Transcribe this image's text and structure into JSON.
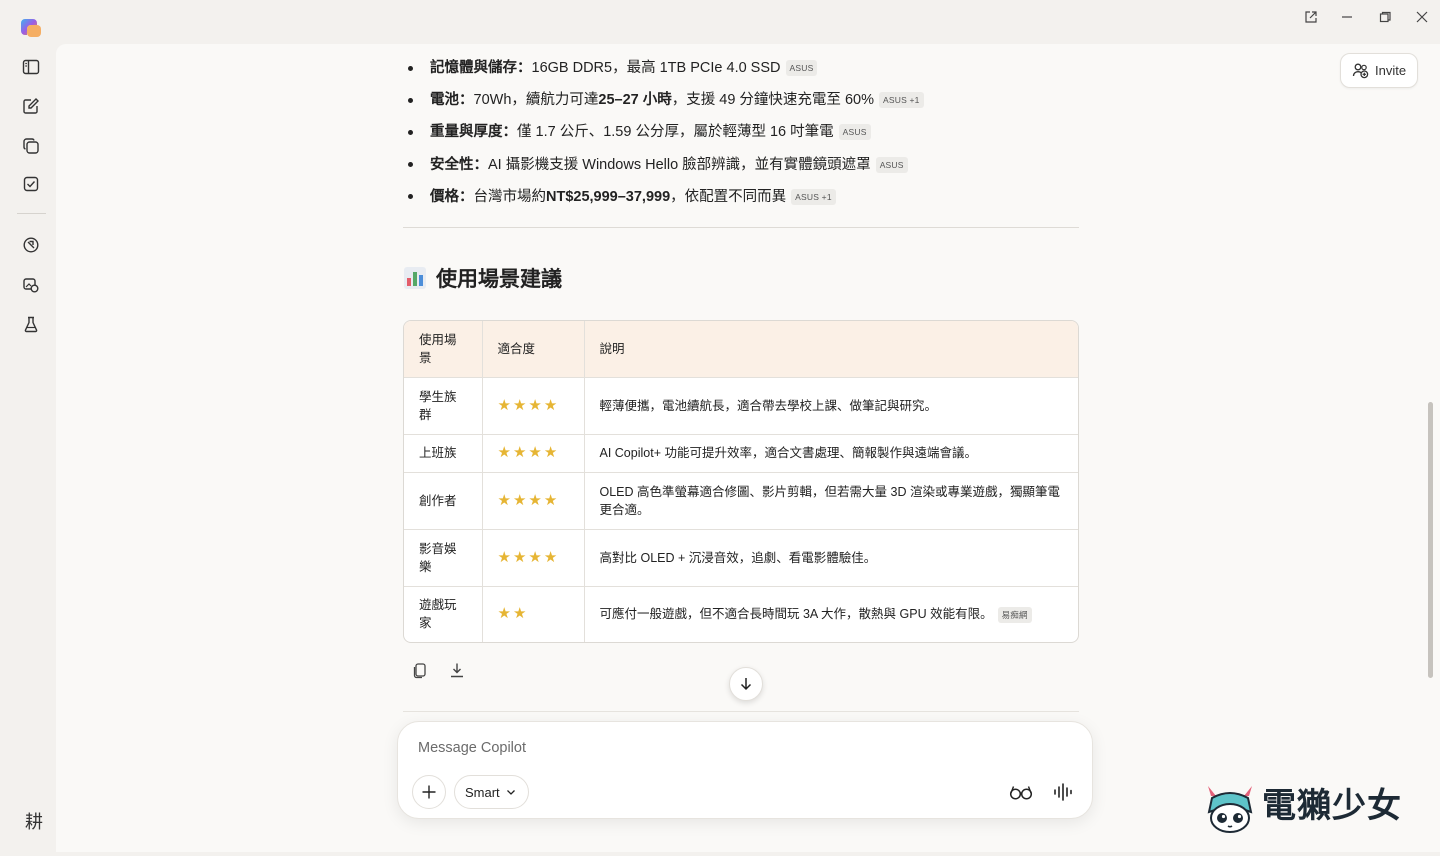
{
  "app": {
    "invite_label": "Invite",
    "user_avatar_text": "耕"
  },
  "specs": [
    {
      "label": "記憶體與儲存",
      "sep": "：",
      "text": "16GB DDR5，最高 1TB PCIe 4.0 SSD",
      "source": "ASUS",
      "extra": ""
    },
    {
      "label": "電池",
      "sep": "：",
      "text_html_parts": [
        "70Wh，續航力可達 ",
        "25–27 小時",
        "，支援 49 分鐘快速充電至 60%"
      ],
      "source": "ASUS",
      "extra": "+1"
    },
    {
      "label": "重量與厚度",
      "sep": "：",
      "text": "僅 1.7 公斤、1.59 公分厚，屬於輕薄型 16 吋筆電",
      "source": "ASUS",
      "extra": ""
    },
    {
      "label": "安全性",
      "sep": "：",
      "text": "AI 攝影機支援 Windows Hello 臉部辨識，並有實體鏡頭遮罩",
      "source": "ASUS",
      "extra": ""
    },
    {
      "label": "價格",
      "sep": "：",
      "text_html_parts": [
        "台灣市場約 ",
        "NT$25,999–37,999",
        "，依配置不同而異"
      ],
      "source": "ASUS",
      "extra": "+1"
    }
  ],
  "section": {
    "title": "使用場景建議"
  },
  "table": {
    "headers": [
      "使用場景",
      "適合度",
      "說明"
    ],
    "rows": [
      {
        "scenario": "學生族群",
        "rating": 4,
        "stars": "★★★★",
        "desc": "輕薄便攜，電池續航長，適合帶去學校上課、做筆記與研究。",
        "source": ""
      },
      {
        "scenario": "上班族",
        "rating": 4,
        "stars": "★★★★",
        "desc": "AI Copilot+ 功能可提升效率，適合文書處理、簡報製作與遠端會議。",
        "source": ""
      },
      {
        "scenario": "創作者",
        "rating": 4,
        "stars": "★★★★",
        "desc": "OLED 高色準螢幕適合修圖、影片剪輯，但若需大量 3D 渲染或專業遊戲，獨顯筆電更合適。",
        "source": ""
      },
      {
        "scenario": "影音娛樂",
        "rating": 4,
        "stars": "★★★★",
        "desc": "高對比 OLED + 沉浸音效，追劇、看電影體驗佳。",
        "source": ""
      },
      {
        "scenario": "遊戲玩家",
        "rating": 2,
        "stars": "★★",
        "desc": "可應付一般遊戲，但不適合長時間玩 3A 大作，散熱與 GPU 效能有限。",
        "source": "易痴網"
      }
    ]
  },
  "composer": {
    "placeholder": "Message Copilot",
    "mode_label": "Smart"
  },
  "watermark": {
    "text": "電獺少女"
  },
  "colors": {
    "star": "#e6b534",
    "table_header_bg": "#fbf0e6",
    "app_bg": "#f3f1ee",
    "panel_bg": "#faf9f7"
  },
  "icons": {
    "sidebar": [
      "sidebar-toggle-icon",
      "new-chat-icon",
      "pages-icon",
      "tasks-icon",
      "discover-icon",
      "image-gallery-icon",
      "labs-icon"
    ],
    "actions": [
      "copy-icon",
      "download-icon"
    ],
    "composer": [
      "plus-icon",
      "chevron-down-icon",
      "vision-glasses-icon",
      "voice-icon"
    ]
  }
}
